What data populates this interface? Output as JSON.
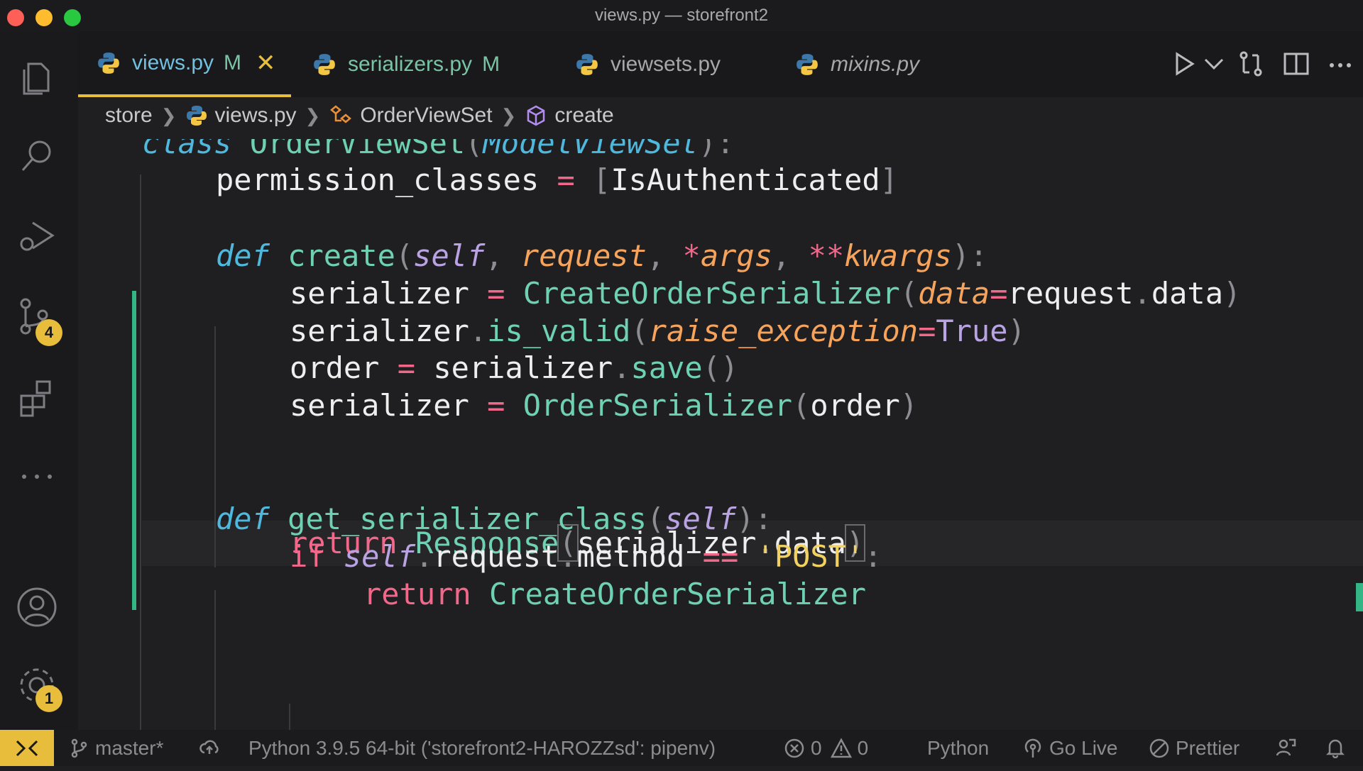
{
  "window": {
    "title": "views.py — storefront2"
  },
  "activity_bar": {
    "source_control_badge": "4",
    "settings_badge": "1"
  },
  "tabs": [
    {
      "label": "views.py",
      "mark": "M"
    },
    {
      "label": "serializers.py",
      "mark": "M"
    },
    {
      "label": "viewsets.py"
    },
    {
      "label": "mixins.py"
    }
  ],
  "breadcrumb": [
    "store",
    "views.py",
    "OrderViewSet",
    "create"
  ],
  "code": {
    "l1": [
      "class",
      "OrderViewSet",
      "(",
      "ModelViewSet",
      "):"
    ],
    "l2": [
      "permission_classes",
      "=",
      "[",
      "IsAuthenticated",
      "]"
    ],
    "l4": [
      "def",
      "create",
      "(",
      "self",
      ",",
      "request",
      ",",
      "*",
      "args",
      ",",
      "**",
      "kwargs",
      "):"
    ],
    "l5": [
      "serializer",
      "=",
      "CreateOrderSerializer",
      "(",
      "data",
      "=",
      "request",
      ".",
      "data",
      ")"
    ],
    "l6": [
      "serializer",
      ".",
      "is_valid",
      "(",
      "raise_exception",
      "=",
      "True",
      ")"
    ],
    "l7": [
      "order",
      "=",
      "serializer",
      ".",
      "save",
      "()"
    ],
    "l8": [
      "serializer",
      "=",
      "OrderSerializer",
      "(",
      "order",
      ")"
    ],
    "l9": [
      "return",
      "Response",
      "(",
      "serializer",
      ".",
      "data",
      ")"
    ],
    "l11": [
      "def",
      "get_serializer_class",
      "(",
      "self",
      "):"
    ],
    "l12": [
      "if",
      "self",
      ".",
      "request",
      ".",
      "method",
      "==",
      "'POST'",
      ":"
    ],
    "l13": [
      "return",
      "CreateOrderSerializer"
    ]
  },
  "status": {
    "branch": "master*",
    "interpreter": "Python 3.9.5 64-bit ('storefront2-HAROZZsd': pipenv)",
    "errors": "0",
    "warnings": "0",
    "language": "Python",
    "golive": "Go Live",
    "prettier": "Prettier"
  },
  "colors": {
    "accent": "#e8bd3b",
    "git_added": "#33b586"
  }
}
